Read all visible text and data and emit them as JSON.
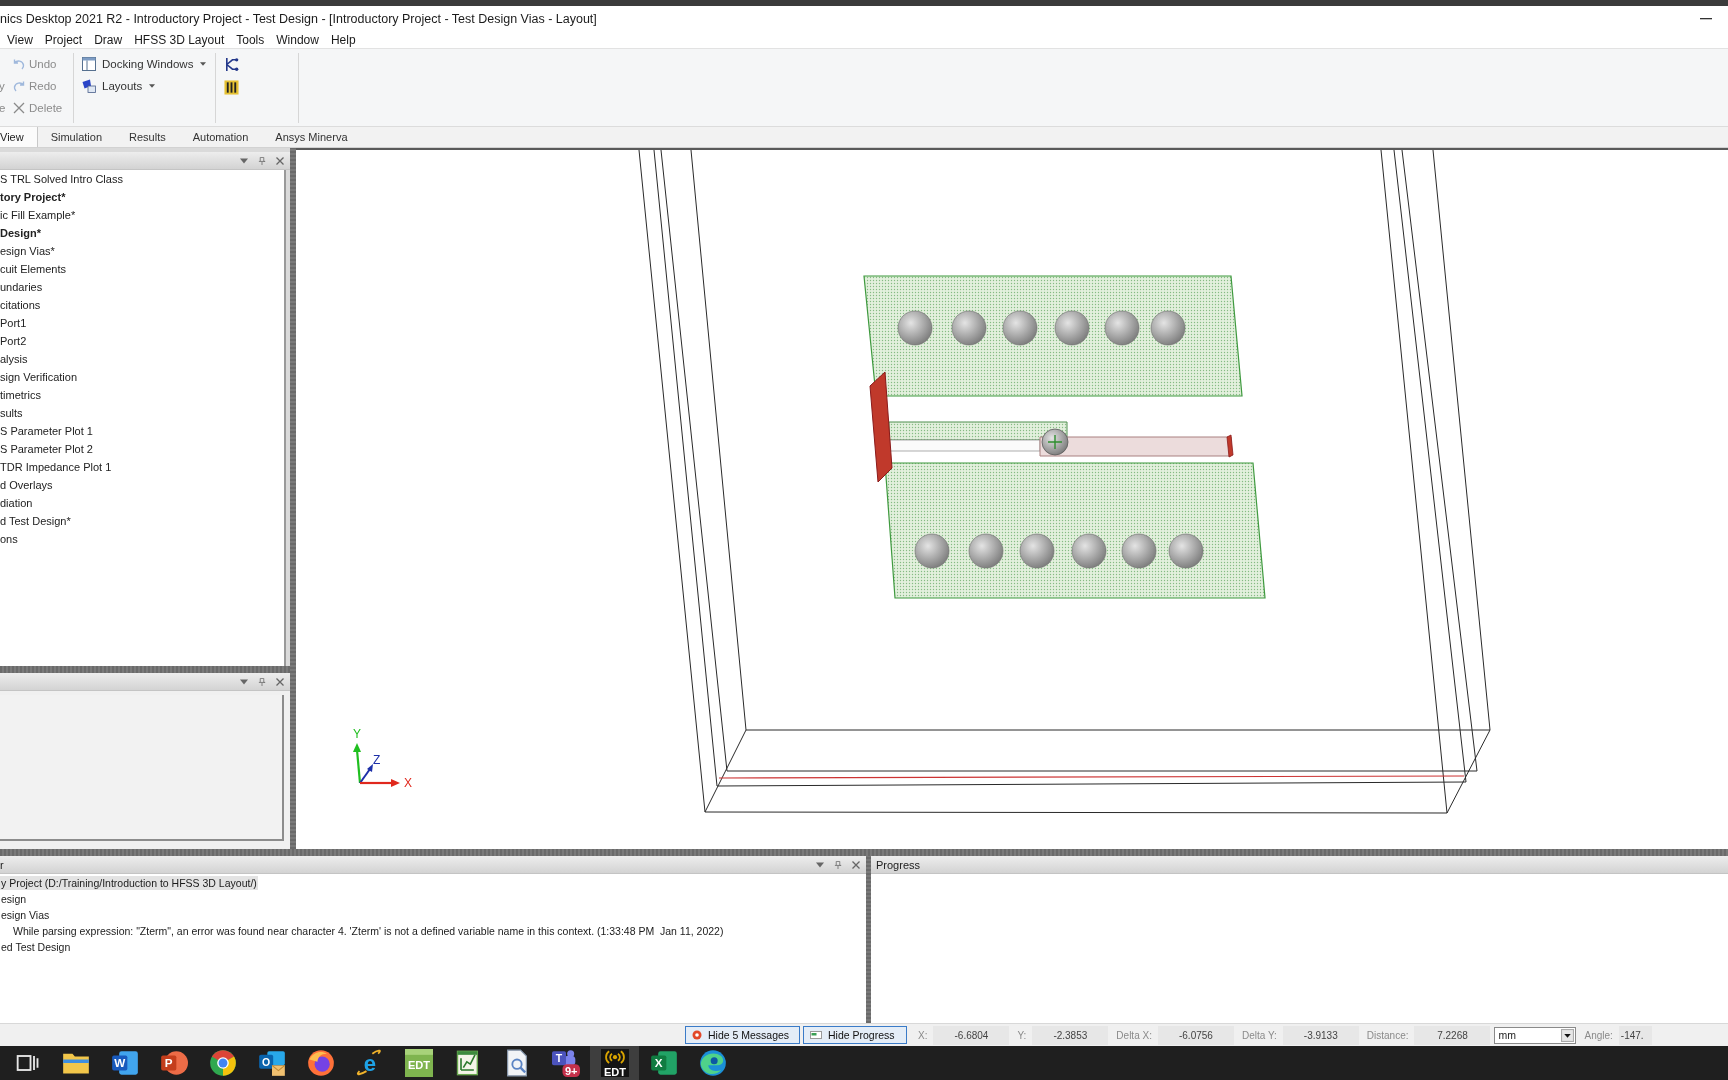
{
  "window": {
    "title": "nics Desktop 2021 R2 - Introductory Project - Test Design - [Introductory Project - Test Design Vias - Layout]"
  },
  "menu": [
    "View",
    "Project",
    "Draw",
    "HFSS 3D Layout",
    "Tools",
    "Window",
    "Help"
  ],
  "ribbon": {
    "clipped_labels": [
      "y",
      "e"
    ],
    "edit_buttons": [
      {
        "kind": "undo",
        "label": "Undo",
        "disabled": true
      },
      {
        "kind": "redo",
        "label": "Redo",
        "disabled": true
      },
      {
        "kind": "delete",
        "label": "Delete",
        "disabled": true
      }
    ],
    "window_buttons": [
      {
        "kind": "docking",
        "label": "Docking Windows"
      },
      {
        "kind": "layouts",
        "label": "Layouts"
      }
    ],
    "tool_buttons": [
      {
        "kind": "circuit"
      },
      {
        "kind": "chip"
      }
    ]
  },
  "tabs": [
    {
      "label": "View",
      "selected": true
    },
    {
      "label": "Simulation",
      "selected": false
    },
    {
      "label": "Results",
      "selected": false
    },
    {
      "label": "Automation",
      "selected": false
    },
    {
      "label": "Ansys Minerva",
      "selected": false
    }
  ],
  "project_tree": [
    {
      "label": "S TRL Solved Intro Class",
      "active": false
    },
    {
      "label": "tory Project*",
      "active": true
    },
    {
      "label": "ic Fill Example*",
      "active": false
    },
    {
      "label": "Design*",
      "active": true
    },
    {
      "label": "esign Vias*",
      "active": false
    },
    {
      "label": "cuit Elements",
      "active": false
    },
    {
      "label": "undaries",
      "active": false
    },
    {
      "label": "citations",
      "active": false
    },
    {
      "label": "Port1",
      "active": false
    },
    {
      "label": "Port2",
      "active": false
    },
    {
      "label": "alysis",
      "active": false
    },
    {
      "label": "sign Verification",
      "active": false
    },
    {
      "label": "timetrics",
      "active": false
    },
    {
      "label": "sults",
      "active": false
    },
    {
      "label": "S Parameter Plot 1",
      "active": false
    },
    {
      "label": "S Parameter Plot 2",
      "active": false
    },
    {
      "label": "TDR Impedance Plot 1",
      "active": false
    },
    {
      "label": "d Overlays",
      "active": false
    },
    {
      "label": "diation",
      "active": false
    },
    {
      "label": "d Test Design*",
      "active": false
    },
    {
      "label": "ons",
      "active": false
    }
  ],
  "viewport": {
    "axes": [
      {
        "kind": "y",
        "label": "Y"
      },
      {
        "kind": "z",
        "label": "Z"
      },
      {
        "kind": "x",
        "label": "X"
      }
    ]
  },
  "message_manager": {
    "title": "r",
    "messages": [
      {
        "kind": "node",
        "text": "y Project (D:/Training/Introduction to HFSS 3D Layout/)",
        "selected": true
      },
      {
        "kind": "node",
        "text": "esign",
        "selected": false
      },
      {
        "kind": "node",
        "text": "esign Vias",
        "selected": false
      },
      {
        "kind": "message",
        "text": "While parsing expression: \"Zterm\", an error was found near character 4. 'Zterm' is not a defined variable name in this context. (1:33:48 PM  Jan 11, 2022)",
        "selected": false
      },
      {
        "kind": "node",
        "text": "ed Test Design",
        "selected": false
      }
    ]
  },
  "progress": {
    "title": "Progress"
  },
  "status_bar": {
    "buttons": [
      {
        "kind": "messages",
        "label": "Hide 5 Messages"
      },
      {
        "kind": "progress",
        "label": "Hide Progress"
      }
    ],
    "fields": [
      {
        "kind": "readout",
        "label": "X:",
        "value": "-6.6804"
      },
      {
        "kind": "readout",
        "label": "Y:",
        "value": "-2.3853"
      },
      {
        "kind": "readout",
        "label": "Delta X:",
        "value": "-6.0756"
      },
      {
        "kind": "readout",
        "label": "Delta Y:",
        "value": "-3.9133"
      },
      {
        "kind": "readout",
        "label": "Distance:",
        "value": "7.2268"
      },
      {
        "kind": "units",
        "value": "mm"
      },
      {
        "kind": "readout",
        "label": "Angle:",
        "value": "-147."
      }
    ]
  },
  "taskbar": [
    {
      "kind": "taskview",
      "selected": false
    },
    {
      "kind": "folder",
      "selected": false
    },
    {
      "kind": "word",
      "glyph": "W",
      "selected": false
    },
    {
      "kind": "powerpoint",
      "glyph": "P",
      "selected": false
    },
    {
      "kind": "chrome",
      "selected": false
    },
    {
      "kind": "outlook",
      "glyph": "O",
      "selected": false
    },
    {
      "kind": "firefox",
      "selected": false
    },
    {
      "kind": "ie",
      "glyph": "e",
      "selected": false
    },
    {
      "kind": "edt",
      "glyph": "EDT",
      "selected": false
    },
    {
      "kind": "notepad",
      "selected": false
    },
    {
      "kind": "viewer",
      "selected": false
    },
    {
      "kind": "teams",
      "glyph": "T",
      "badge": "9+",
      "selected": false
    },
    {
      "kind": "edt_dark",
      "glyph": "EDT",
      "selected": true
    },
    {
      "kind": "excel",
      "glyph": "X",
      "selected": false
    },
    {
      "kind": "edge",
      "selected": false
    }
  ]
}
